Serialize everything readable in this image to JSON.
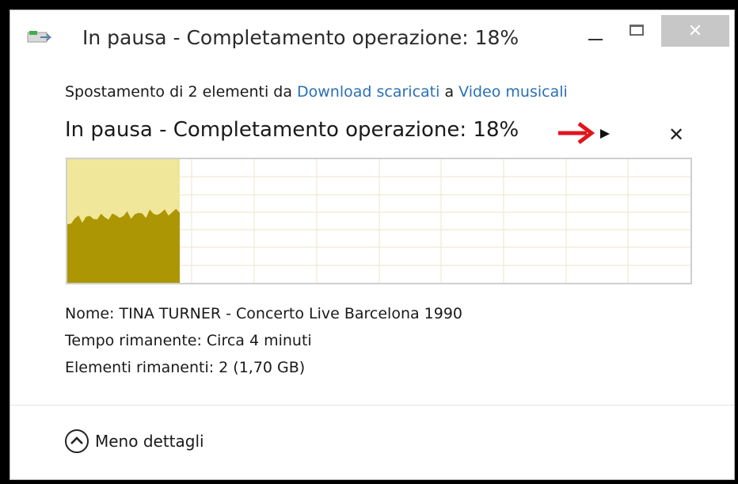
{
  "window": {
    "title": "In pausa - Completamento operazione: 18%",
    "close_glyph": "✕",
    "icons": {
      "app": "file-move-icon",
      "minimize": "minimize-icon",
      "maximize": "maximize-icon",
      "close": "close-icon"
    }
  },
  "operation": {
    "subtitle_prefix": "Spostamento di 2 elementi da ",
    "source": "Download scaricati",
    "subtitle_middle": " a ",
    "destination": "Video musicali",
    "status": "In pausa - Completamento operazione: 18%",
    "progress_percent": 18,
    "cancel_glyph": "✕",
    "icons": {
      "resume": "play-icon",
      "annotation": "red-arrow-icon",
      "cancel": "close-icon"
    }
  },
  "details": {
    "name_line": "Nome: TINA TURNER - Concerto Live Barcelona 1990",
    "time_line": "Tempo rimanente: Circa 4 minuti",
    "items_line": "Elementi rimanenti: 2 (1,70 GB)"
  },
  "footer": {
    "less_details_label": "Meno dettagli",
    "icon": "chevron-up-circle-icon"
  },
  "colors": {
    "graph_fill_light": "#f0e79a",
    "graph_fill_dark": "#ad9603",
    "grid": "#ece6c8",
    "link": "#2a70b5",
    "arrow": "#e0161b"
  }
}
